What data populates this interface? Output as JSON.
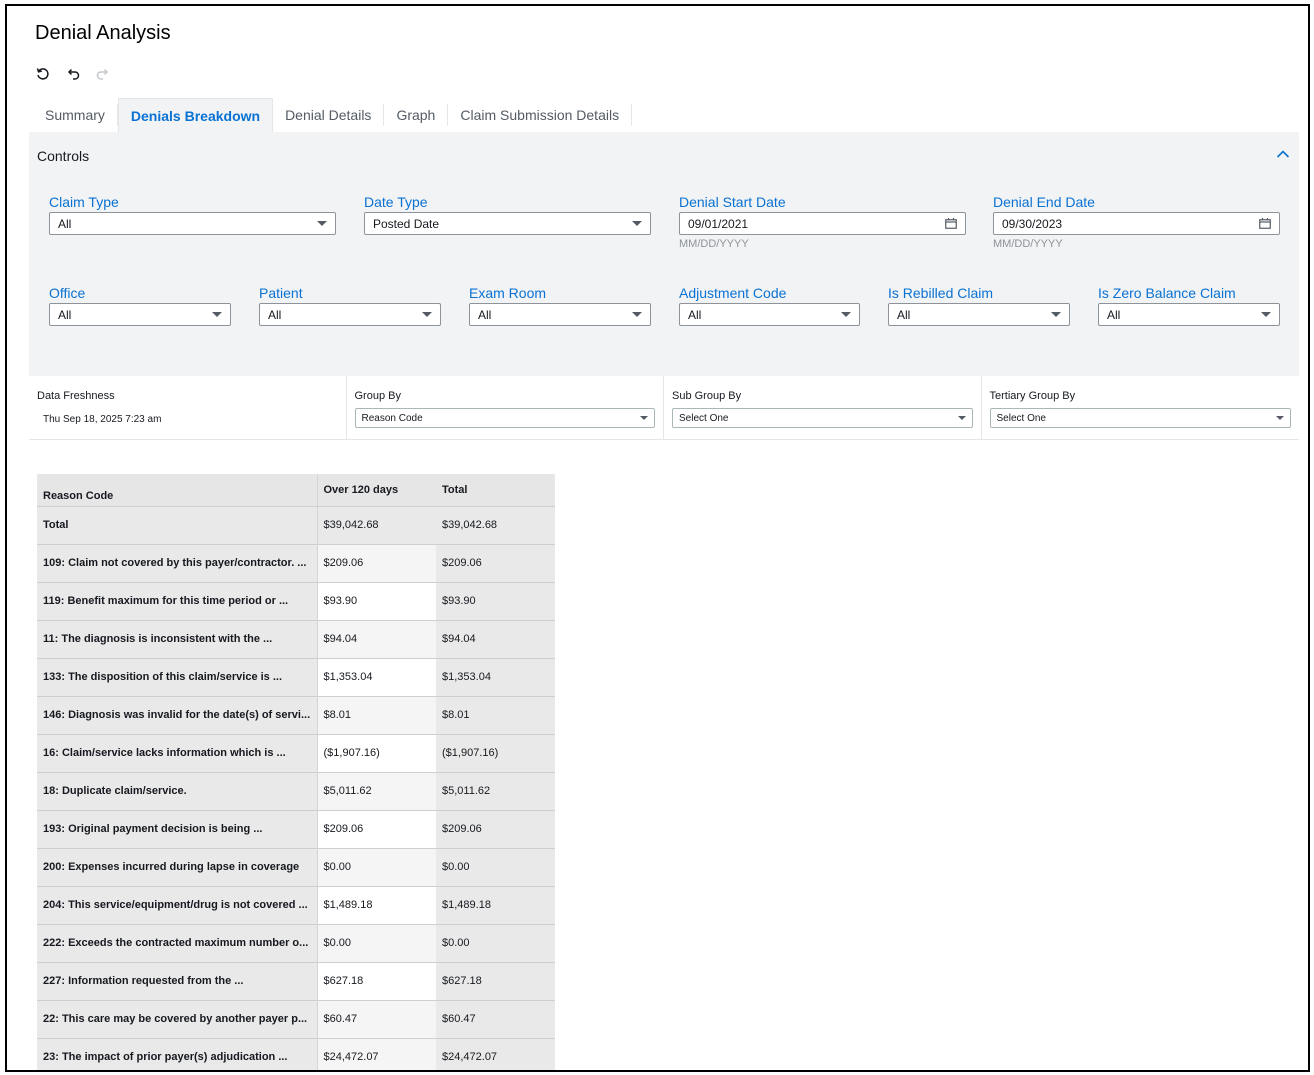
{
  "app": {
    "title": "Denial Analysis"
  },
  "toolbar": {
    "icons": [
      "refresh-icon",
      "undo-icon",
      "redo-icon"
    ]
  },
  "tabs": [
    {
      "label": "Summary",
      "active": false
    },
    {
      "label": "Denials Breakdown",
      "active": true
    },
    {
      "label": "Denial Details",
      "active": false
    },
    {
      "label": "Graph",
      "active": false
    },
    {
      "label": "Claim Submission Details",
      "active": false
    }
  ],
  "controls": {
    "label": "Controls",
    "claim_type": {
      "label": "Claim Type",
      "value": "All"
    },
    "date_type": {
      "label": "Date Type",
      "value": "Posted Date"
    },
    "denial_start": {
      "label": "Denial Start Date",
      "value": "09/01/2021",
      "hint": "MM/DD/YYYY"
    },
    "denial_end": {
      "label": "Denial End Date",
      "value": "09/30/2023",
      "hint": "MM/DD/YYYY"
    },
    "office": {
      "label": "Office",
      "value": "All"
    },
    "patient": {
      "label": "Patient",
      "value": "All"
    },
    "exam_room": {
      "label": "Exam Room",
      "value": "All"
    },
    "adjustment_code": {
      "label": "Adjustment Code",
      "value": "All"
    },
    "is_rebilled": {
      "label": "Is Rebilled Claim",
      "value": "All"
    },
    "is_zero_balance": {
      "label": "Is Zero Balance Claim",
      "value": "All"
    }
  },
  "bar": {
    "freshness_label": "Data Freshness",
    "freshness_value": "Thu Sep 18, 2025 7:23 am",
    "group_by": {
      "label": "Group By",
      "value": "Reason Code"
    },
    "sub_group_by": {
      "label": "Sub Group By",
      "value": "Select One"
    },
    "tertiary_group_by": {
      "label": "Tertiary Group By",
      "value": "Select One"
    }
  },
  "table": {
    "headers": [
      "Reason Code",
      "Over 120 days",
      "Total"
    ],
    "rows": [
      [
        "Total",
        "$39,042.68",
        "$39,042.68"
      ],
      [
        "109: Claim not covered by this payer/contractor. ...",
        "$209.06",
        "$209.06"
      ],
      [
        "119: Benefit maximum for this time period or ...",
        "$93.90",
        "$93.90"
      ],
      [
        "11: The diagnosis is inconsistent with the ...",
        "$94.04",
        "$94.04"
      ],
      [
        "133: The disposition of this claim/service is ...",
        "$1,353.04",
        "$1,353.04"
      ],
      [
        "146: Diagnosis was invalid for the date(s) of servi...",
        "$8.01",
        "$8.01"
      ],
      [
        "16: Claim/service lacks information which is ...",
        "($1,907.16)",
        "($1,907.16)"
      ],
      [
        "18: Duplicate claim/service.",
        "$5,011.62",
        "$5,011.62"
      ],
      [
        "193: Original payment decision is being ...",
        "$209.06",
        "$209.06"
      ],
      [
        "200: Expenses incurred during lapse in coverage",
        "$0.00",
        "$0.00"
      ],
      [
        "204: This service/equipment/drug is not covered ...",
        "$1,489.18",
        "$1,489.18"
      ],
      [
        "222: Exceeds the contracted maximum number o...",
        "$0.00",
        "$0.00"
      ],
      [
        "227: Information requested from the ...",
        "$627.18",
        "$627.18"
      ],
      [
        "22: This care may be covered by another payer p...",
        "$60.47",
        "$60.47"
      ],
      [
        "23: The impact of prior payer(s) adjudication ...",
        "$24,472.07",
        "$24,472.07"
      ]
    ]
  }
}
